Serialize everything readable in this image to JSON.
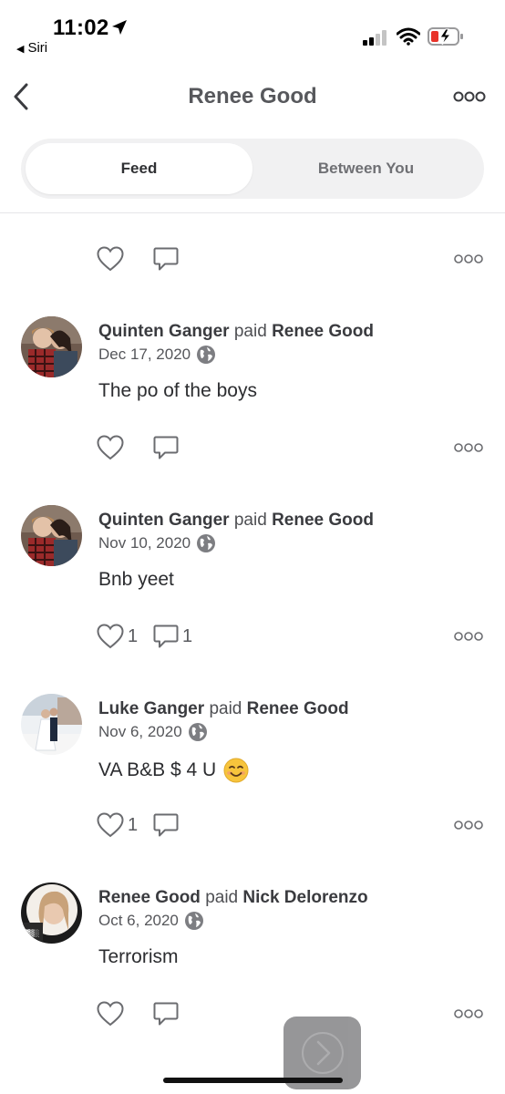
{
  "status_bar": {
    "time": "11:02",
    "back_label": "Siri"
  },
  "header": {
    "title": "Renee Good"
  },
  "tabs": [
    {
      "label": "Feed",
      "selected": true
    },
    {
      "label": "Between You",
      "selected": false
    }
  ],
  "top_actions": {
    "likes": "",
    "comments": ""
  },
  "posts": [
    {
      "payer": "Quinten Ganger",
      "verb": "paid",
      "payee": "Renee Good",
      "date": "Dec 17, 2020",
      "privacy_icon": "globe-icon",
      "note": "The po of the boys",
      "likes": "",
      "comments": "",
      "avatar": "couple-photo"
    },
    {
      "payer": "Quinten Ganger",
      "verb": "paid",
      "payee": "Renee Good",
      "date": "Nov 10, 2020",
      "privacy_icon": "globe-icon",
      "note": "Bnb yeet",
      "likes": "1",
      "comments": "1",
      "avatar": "couple-photo"
    },
    {
      "payer": "Luke Ganger",
      "verb": "paid",
      "payee": "Renee Good",
      "date": "Nov 6, 2020",
      "privacy_icon": "globe-icon",
      "note": "VA B&B $ 4 U",
      "note_emoji": "smiling-face-emoji",
      "likes": "1",
      "comments": "",
      "avatar": "wedding-photo"
    },
    {
      "payer": "Renee Good",
      "verb": "paid",
      "payee": "Nick Delorenzo",
      "date": "Oct 6, 2020",
      "privacy_icon": "globe-icon",
      "note": "Terrorism",
      "likes": "",
      "comments": "",
      "avatar": "selfie-photo"
    }
  ],
  "colors": {
    "text": "#2f3033",
    "muted": "#6f7074",
    "icon": "#6b6c70",
    "segment_bg": "#f1f1f2"
  }
}
